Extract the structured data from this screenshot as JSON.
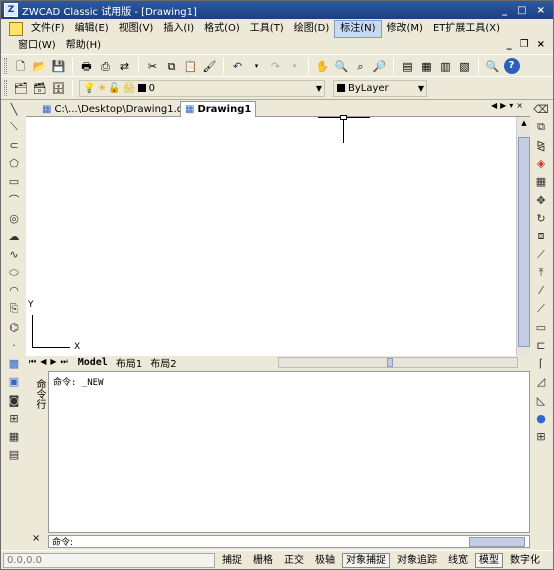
{
  "window": {
    "title": "ZWCAD Classic 试用版 - [Drawing1]",
    "buttons": [
      "_",
      "□",
      "×"
    ]
  },
  "menus": {
    "row1": [
      "文件(F)",
      "编辑(E)",
      "视图(V)",
      "插入(I)",
      "格式(O)",
      "工具(T)",
      "绘图(D)",
      "标注(N)",
      "修改(M)",
      "ET扩展工具(X)"
    ],
    "row2": [
      "窗口(W)",
      "帮助(H)"
    ],
    "active": "标注(N)",
    "mdi_buttons": [
      "_",
      "❐",
      "×"
    ]
  },
  "toolbar2": {
    "layer_value": "0",
    "color_value": "ByLayer"
  },
  "tabs": {
    "file1": "C:\\...\\Desktop\\Drawing1.dwg",
    "file2": "Drawing1"
  },
  "ucs": {
    "x_label": "X",
    "y_label": "Y"
  },
  "layouts": [
    "Model",
    "布局1",
    "布局2"
  ],
  "command": {
    "handle_label": "命令行",
    "history": "命令: _NEW",
    "prompt": "命令:"
  },
  "status": {
    "coords": "0.0,0.0",
    "buttons": [
      {
        "label": "捕捉",
        "on": false
      },
      {
        "label": "栅格",
        "on": false
      },
      {
        "label": "正交",
        "on": false
      },
      {
        "label": "极轴",
        "on": false
      },
      {
        "label": "对象捕捉",
        "on": true
      },
      {
        "label": "对象追踪",
        "on": false
      },
      {
        "label": "线宽",
        "on": false
      },
      {
        "label": "模型",
        "on": true
      },
      {
        "label": "数字化",
        "on": false
      }
    ]
  },
  "icons": {
    "toolbar1": [
      "new-icon",
      "open-icon",
      "save-icon",
      "print-icon",
      "preview-icon",
      "publish-icon",
      "cut-icon",
      "copy-icon",
      "paste-icon",
      "match-icon",
      "undo-icon",
      "redo-icon",
      "pan-icon",
      "zoom-realtime-icon",
      "zoom-window-icon",
      "zoom-previous-icon",
      "properties-icon",
      "design-center-icon",
      "tool-palette-icon",
      "sheet-icon",
      "calculator-icon",
      "help-icon"
    ],
    "left": [
      "line-icon",
      "xline-icon",
      "polyline-icon",
      "polygon-icon",
      "rectangle-icon",
      "arc-icon",
      "circle-icon",
      "cloud-icon",
      "spline-icon",
      "ellipse-icon",
      "ellipse-arc-icon",
      "insert-block-icon",
      "make-block-icon",
      "point-icon",
      "hatch-icon",
      "gradient-icon",
      "region-icon",
      "table-icon",
      "image-icon",
      "mtext-icon"
    ],
    "right": [
      "erase-icon",
      "copy-object-icon",
      "mirror-icon",
      "offset-icon",
      "array-icon",
      "move-icon",
      "rotate-icon",
      "scale-icon",
      "stretch-icon",
      "trim-icon",
      "extend-icon",
      "break-icon",
      "join-icon",
      "chamfer-icon",
      "fillet-icon",
      "explode-icon"
    ]
  }
}
